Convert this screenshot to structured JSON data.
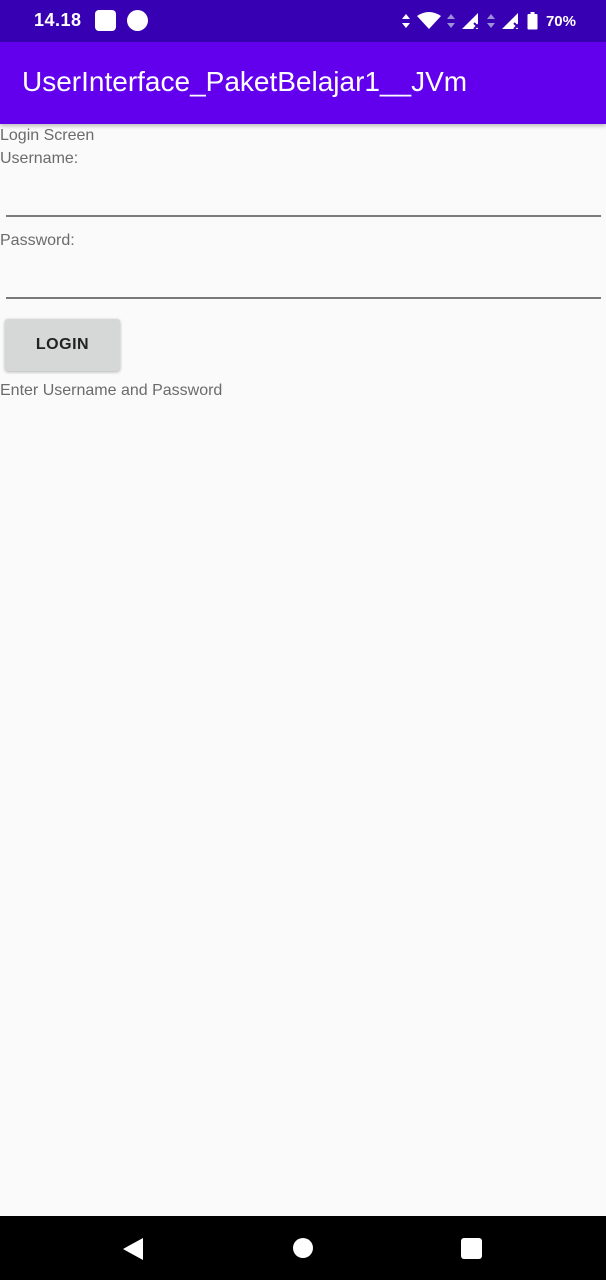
{
  "status_bar": {
    "time": "14.18",
    "battery_percent": "70%",
    "icons": [
      "notification-square-icon",
      "notification-circle-icon",
      "wifi-icon",
      "signal-icon",
      "signal-icon",
      "battery-icon"
    ]
  },
  "app_bar": {
    "title": "UserInterface_PaketBelajar1__JVm",
    "color": "#6200ee"
  },
  "login": {
    "screen_label": "Login Screen",
    "username_label": "Username:",
    "username_value": "",
    "password_label": "Password:",
    "password_value": "",
    "login_button": "LOGIN",
    "status_message": "Enter Username and Password"
  },
  "nav_bar": {
    "icons": [
      "back-icon",
      "home-icon",
      "recents-icon"
    ]
  }
}
